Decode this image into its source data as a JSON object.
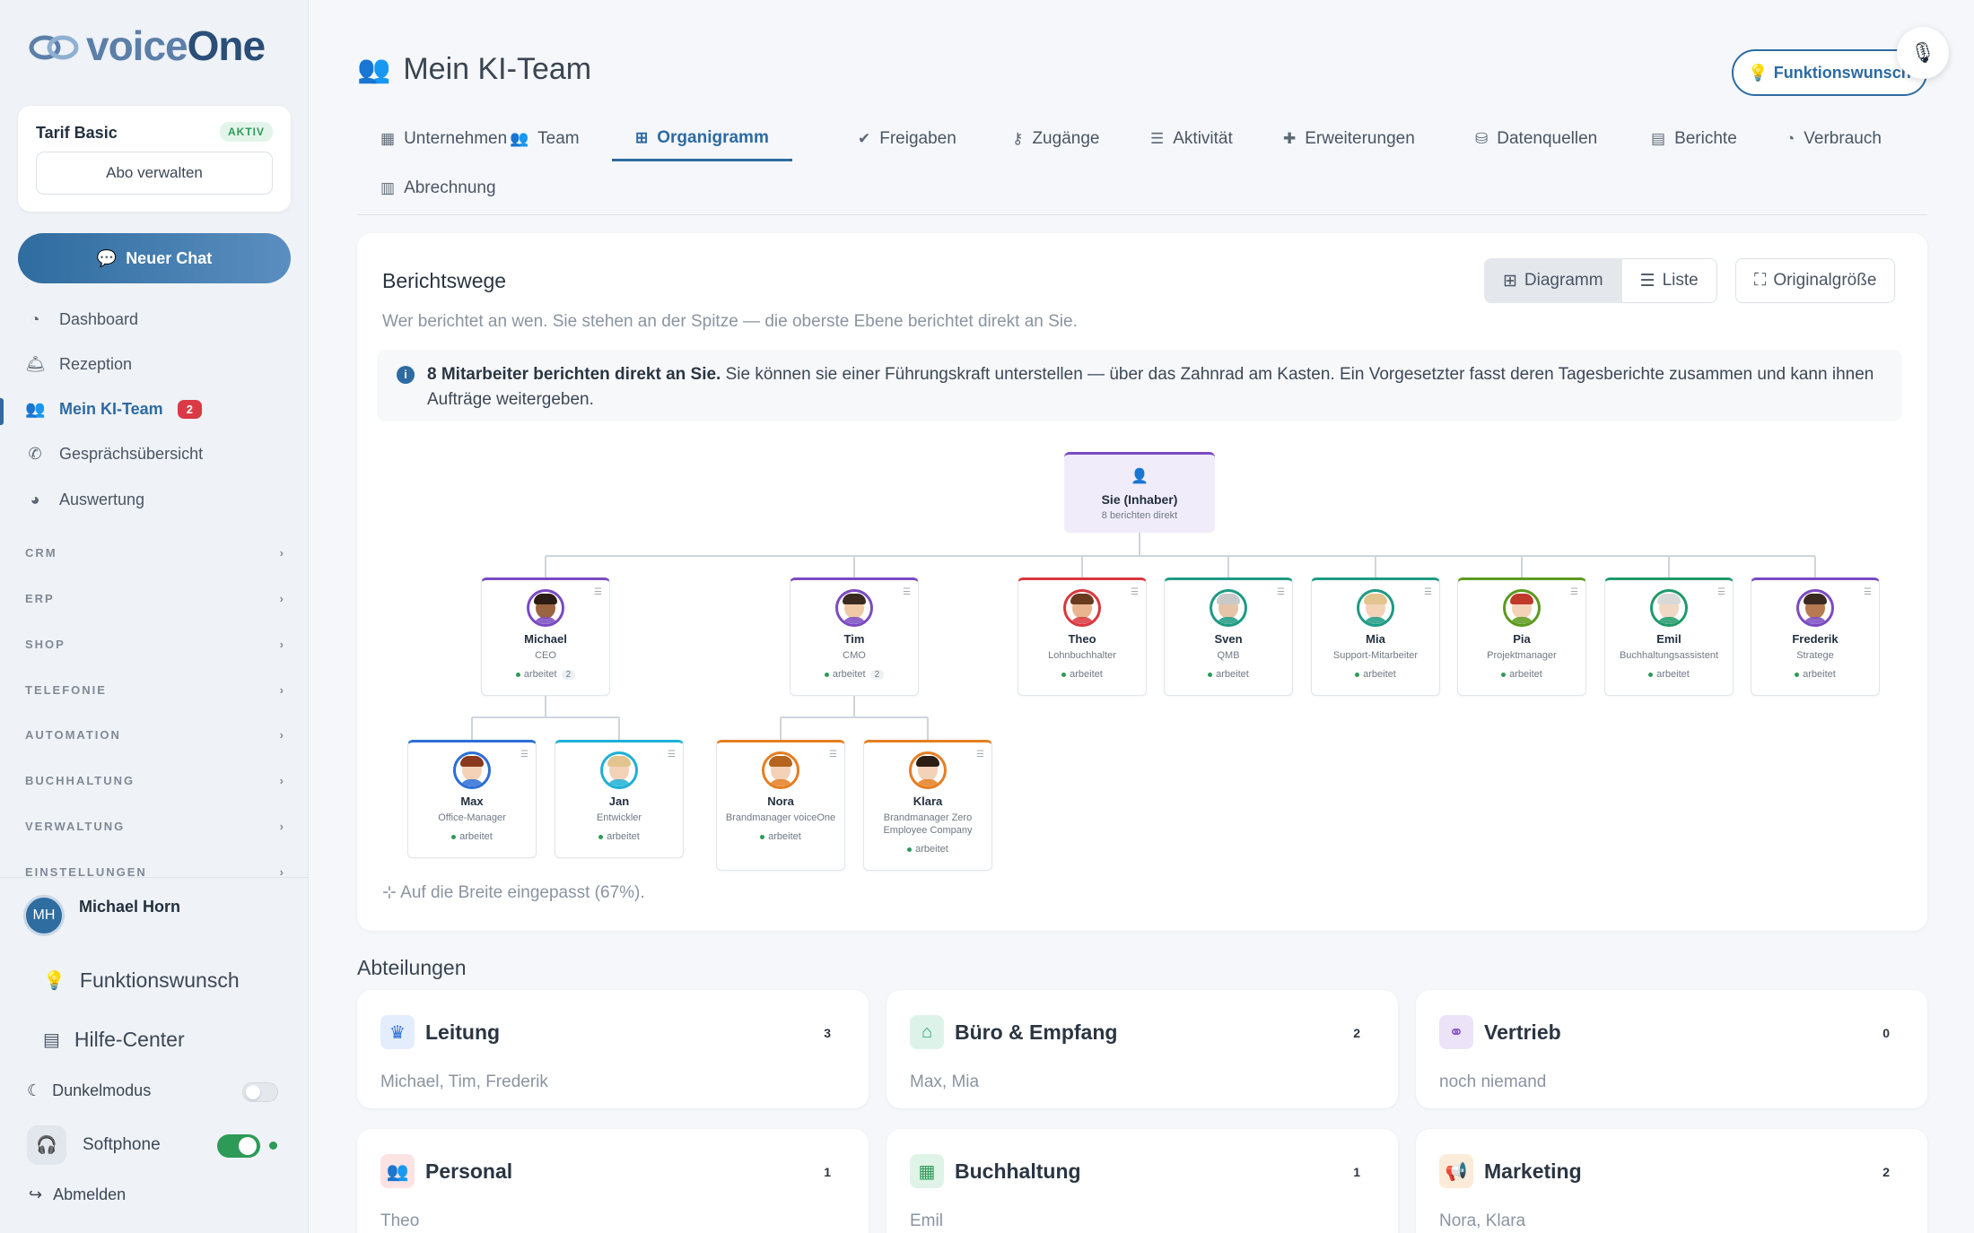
{
  "app": {
    "logo_light": "voice",
    "logo_bold": "One"
  },
  "plan": {
    "name": "Tarif Basic",
    "status": "AKTIV",
    "manage": "Abo verwalten"
  },
  "new_chat": "Neuer Chat",
  "nav": [
    {
      "label": "Dashboard",
      "icon": "gauge-icon"
    },
    {
      "label": "Rezeption",
      "icon": "reception-bell-icon"
    },
    {
      "label": "Mein KI-Team",
      "icon": "users-gear-icon",
      "badge": "2",
      "active": true
    },
    {
      "label": "Gesprächsübersicht",
      "icon": "phone-icon"
    },
    {
      "label": "Auswertung",
      "icon": "pie-chart-icon"
    }
  ],
  "sections": [
    "CRM",
    "ERP",
    "SHOP",
    "TELEFONIE",
    "AUTOMATION",
    "BUCHHALTUNG",
    "VERWALTUNG",
    "EINSTELLUNGEN"
  ],
  "user": {
    "initials": "MH",
    "name": "Michael Horn"
  },
  "bottom_links": {
    "feature": "Funktionswunsch",
    "help": "Hilfe-Center",
    "dark": "Dunkelmodus",
    "softphone": "Softphone",
    "logout": "Abmelden"
  },
  "page": {
    "title": "Mein KI-Team",
    "feature_button": "Funktionswunsch"
  },
  "tabs": [
    {
      "label": "Unternehmen",
      "icon": "building-icon"
    },
    {
      "label": "Team",
      "icon": "users-icon"
    },
    {
      "label": "Organigramm",
      "icon": "sitemap-icon",
      "active": true
    },
    {
      "label": "Freigaben",
      "icon": "check-double-icon"
    },
    {
      "label": "Zugänge",
      "icon": "key-icon"
    },
    {
      "label": "Aktivität",
      "icon": "list-check-icon"
    },
    {
      "label": "Erweiterungen",
      "icon": "puzzle-icon"
    },
    {
      "label": "Datenquellen",
      "icon": "database-icon"
    },
    {
      "label": "Berichte",
      "icon": "file-icon"
    },
    {
      "label": "Verbrauch",
      "icon": "gauge-icon"
    },
    {
      "label": "Abrechnung",
      "icon": "receipt-icon"
    }
  ],
  "org": {
    "title": "Berichtswege",
    "subtitle": "Wer berichtet an wen. Sie stehen an der Spitze — die oberste Ebene berichtet direkt an Sie.",
    "views": {
      "diagram": "Diagramm",
      "list": "Liste",
      "original": "Originalgröße"
    },
    "info_bold": "8 Mitarbeiter berichten direkt an Sie.",
    "info_text": " Sie können sie einer Führungskraft unterstellen — über das Zahnrad am Kasten. Ein Vorgesetzter fasst deren Tagesberichte zusammen und kann ihnen Aufträge weitergeben.",
    "root": {
      "name": "Sie (Inhaber)",
      "sub": "8 berichten direkt"
    },
    "status_label": "arbeitet",
    "nodes": [
      {
        "name": "Michael",
        "role": "CEO",
        "count": "2",
        "color": "#7a4bc2",
        "skin": "#9a6440",
        "hair": "#2b1d14"
      },
      {
        "name": "Tim",
        "role": "CMO",
        "count": "2",
        "color": "#7a4bc2",
        "skin": "#f0c9a6",
        "hair": "#3b2a20"
      },
      {
        "name": "Theo",
        "role": "Lohnbuchhalter",
        "color": "#d9373f",
        "skin": "#e8b58f",
        "hair": "#6a3a1e"
      },
      {
        "name": "Sven",
        "role": "QMB",
        "color": "#1f9a84",
        "skin": "#e6c4a8",
        "hair": "#c9c9c9"
      },
      {
        "name": "Mia",
        "role": "Support-Mitarbeiter",
        "color": "#1f9a84",
        "skin": "#f3d2b8",
        "hair": "#e4c48e"
      },
      {
        "name": "Pia",
        "role": "Projektmanager",
        "color": "#5c9a1f",
        "skin": "#f3d2b8",
        "hair": "#c0392b"
      },
      {
        "name": "Emil",
        "role": "Buchhaltungsassistent",
        "color": "#1f9a6a",
        "skin": "#f1d8c4",
        "hair": "#d9d9d9"
      },
      {
        "name": "Frederik",
        "role": "Stratege",
        "color": "#7a4bc2",
        "skin": "#b57a52",
        "hair": "#3b2a20"
      },
      {
        "name": "Max",
        "role": "Office-Manager",
        "color": "#2b6fd6",
        "skin": "#f3d2b8",
        "hair": "#8a3a1e"
      },
      {
        "name": "Jan",
        "role": "Entwickler",
        "color": "#1fb0d6",
        "skin": "#f3d2b8",
        "hair": "#e4c48e"
      },
      {
        "name": "Nora",
        "role": "Brandmanager voiceOne",
        "color": "#e67e22",
        "skin": "#f3d2b8",
        "hair": "#b5651d"
      },
      {
        "name": "Klara",
        "role": "Brandmanager Zero Employee Company",
        "color": "#e67e22",
        "skin": "#f3d2b8",
        "hair": "#2b1d14"
      }
    ],
    "fit_note": "Auf die Breite eingepasst (67%)."
  },
  "departments_title": "Abteilungen",
  "departments": [
    {
      "name": "Leitung",
      "count": "3",
      "members": "Michael, Tim, Frederik",
      "icon": "crown-icon",
      "color": "#2b6fd6",
      "bg": "#e3edfb"
    },
    {
      "name": "Büro & Empfang",
      "count": "2",
      "members": "Max, Mia",
      "icon": "inbox-icon",
      "color": "#1fa37a",
      "bg": "#ddf3ea"
    },
    {
      "name": "Vertrieb",
      "count": "0",
      "members": "noch niemand",
      "icon": "handshake-icon",
      "color": "#7a4bc2",
      "bg": "#ece3f8"
    },
    {
      "name": "Personal",
      "count": "1",
      "members": "Theo",
      "icon": "users-icon",
      "color": "#d9373f",
      "bg": "#fbe3e4"
    },
    {
      "name": "Buchhaltung",
      "count": "1",
      "members": "Emil",
      "icon": "spreadsheet-icon",
      "color": "#2e9a58",
      "bg": "#dff3e6"
    },
    {
      "name": "Marketing",
      "count": "2",
      "members": "Nora, Klara",
      "icon": "megaphone-icon",
      "color": "#e67e22",
      "bg": "#fcebd9"
    }
  ]
}
